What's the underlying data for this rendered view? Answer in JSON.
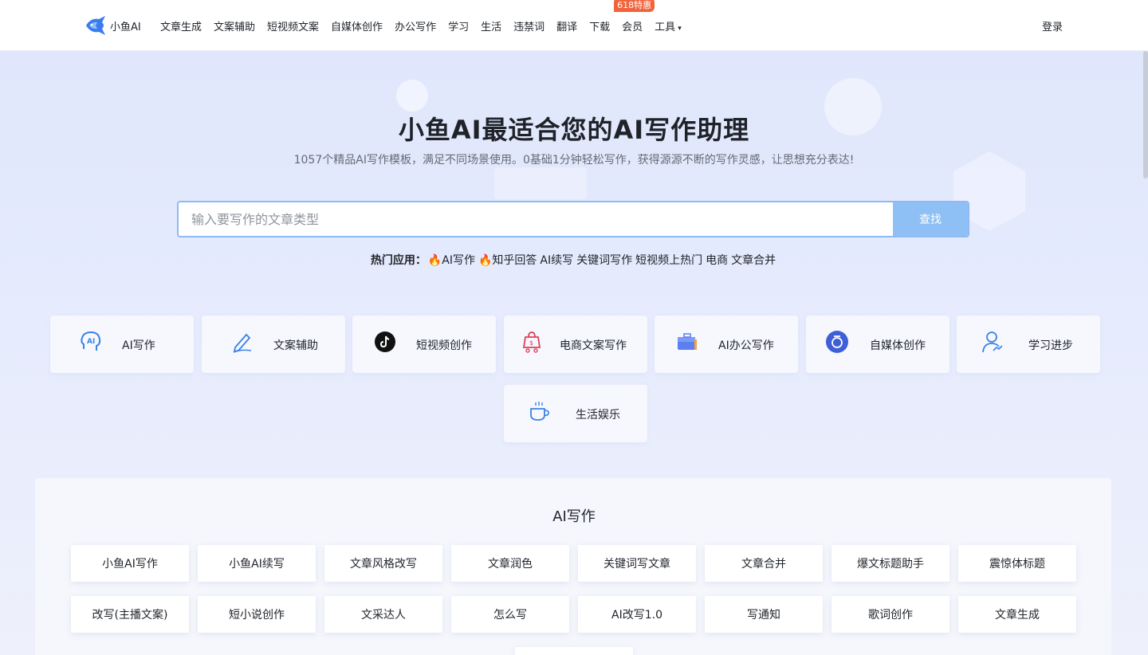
{
  "brand": {
    "name": "小鱼AI"
  },
  "nav": {
    "items": [
      "文章生成",
      "文案辅助",
      "短视频文案",
      "自媒体创作",
      "办公写作",
      "学习",
      "生活",
      "违禁词",
      "翻译",
      "下载",
      "会员",
      "工具"
    ],
    "member_badge": "618特惠",
    "login": "登录"
  },
  "hero": {
    "title": "小鱼AI最适合您的AI写作助理",
    "subtitle": "1057个精品AI写作模板，满足不同场景使用。0基础1分钟轻松写作，获得源源不断的写作灵感，让思想充分表达!"
  },
  "search": {
    "placeholder": "输入要写作的文章类型",
    "value": "",
    "button": "查找"
  },
  "hot": {
    "label": "热门应用：",
    "links": [
      "🔥AI写作",
      "🔥知乎回答",
      "AI续写",
      "关键词写作",
      "短视频上热门",
      "电商",
      "文章合并"
    ]
  },
  "categories": [
    {
      "label": "AI写作",
      "icon": "ai-head-icon"
    },
    {
      "label": "文案辅助",
      "icon": "pen-writing-icon"
    },
    {
      "label": "短视频创作",
      "icon": "tiktok-icon"
    },
    {
      "label": "电商文案写作",
      "icon": "shopping-bag-icon"
    },
    {
      "label": "AI办公写作",
      "icon": "briefcase-icon"
    },
    {
      "label": "自媒体创作",
      "icon": "media-badge-icon"
    },
    {
      "label": "学习进步",
      "icon": "learner-icon"
    },
    {
      "label": "生活娱乐",
      "icon": "coffee-cup-icon"
    }
  ],
  "tools_panel": {
    "title": "AI写作",
    "items": [
      "小鱼AI写作",
      "小鱼AI续写",
      "文章风格改写",
      "文章润色",
      "关键词写文章",
      "文章合并",
      "爆文标题助手",
      "震惊体标题",
      "改写(主播文案)",
      "短小说创作",
      "文采达人",
      "怎么写",
      "AI改写1.0",
      "写通知",
      "歌词创作",
      "文章生成"
    ]
  },
  "colors": {
    "accent": "#8ec0f6",
    "search_border": "#8dbaf3",
    "badge": "#f0643c",
    "text": "#1f2329",
    "subtext": "#646a73"
  }
}
